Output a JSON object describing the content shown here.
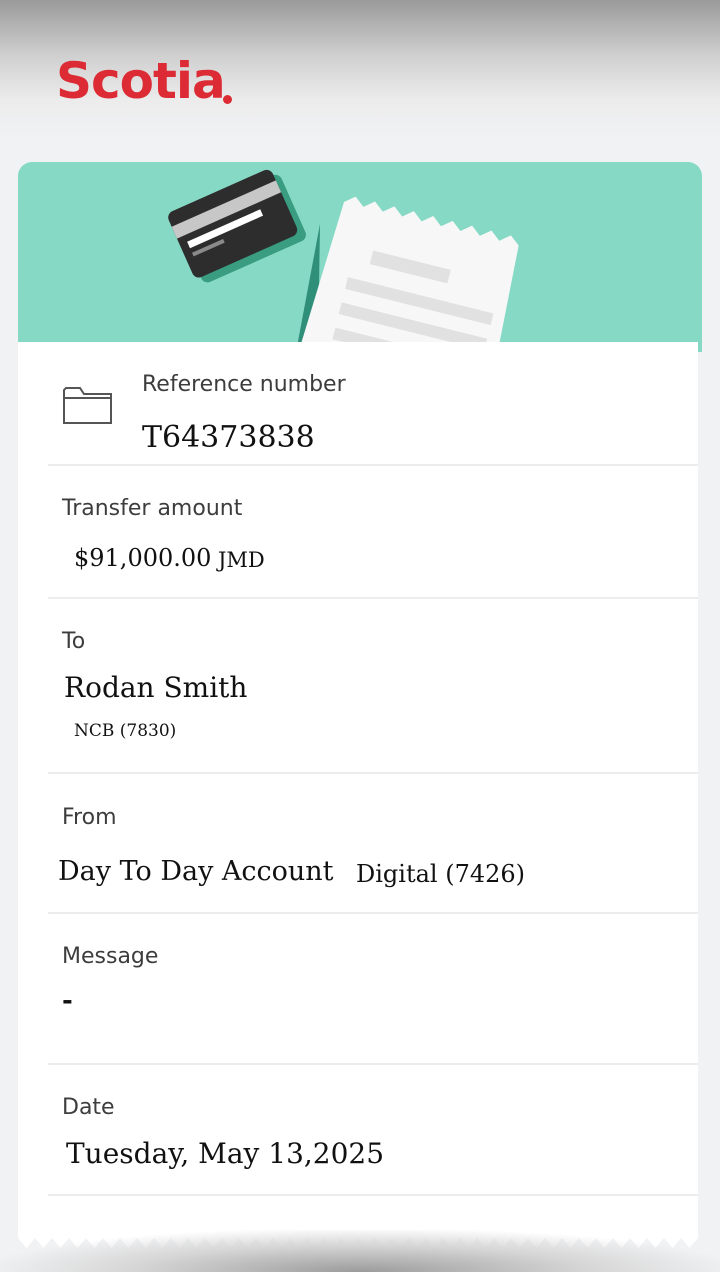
{
  "brand": {
    "logo_text": "Scotia",
    "logo_color": "#dc2b34"
  },
  "banner": {
    "color": "#86d9c4"
  },
  "receipt": {
    "reference": {
      "label": "Reference number",
      "value": "T64373838"
    },
    "amount": {
      "label": "Transfer amount",
      "value": "$91,000.00",
      "currency": "JMD"
    },
    "to": {
      "label": "To",
      "name": "Rodan Smith",
      "account": "NCB (7830)"
    },
    "from": {
      "label": "From",
      "account": "Day To Day Account",
      "account_detail": "Digital (7426)"
    },
    "message": {
      "label": "Message",
      "value": "-"
    },
    "date": {
      "label": "Date",
      "value": "Tuesday, May 13,2025"
    }
  },
  "icons": {
    "reference": "folder-icon",
    "banner_card": "credit-card-icon",
    "banner_receipt": "receipt-icon"
  }
}
